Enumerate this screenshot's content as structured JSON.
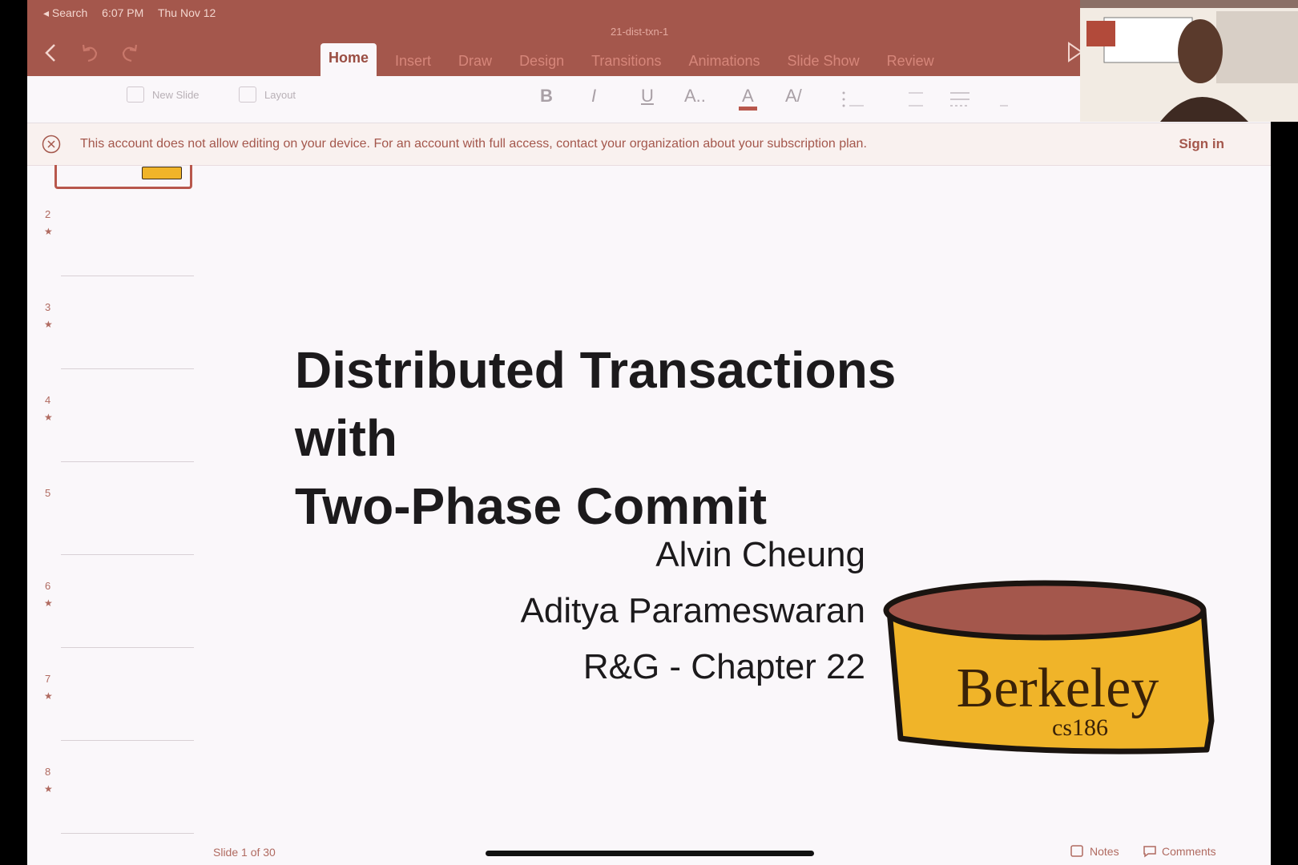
{
  "status_bar": {
    "back": "◂ Search",
    "time": "6:07 PM",
    "date": "Thu Nov 12"
  },
  "document": {
    "title": "21-dist-txn-1"
  },
  "tabs": [
    {
      "label": "Home",
      "active": true
    },
    {
      "label": "Insert"
    },
    {
      "label": "Draw"
    },
    {
      "label": "Design"
    },
    {
      "label": "Transitions"
    },
    {
      "label": "Animations"
    },
    {
      "label": "Slide Show"
    },
    {
      "label": "Review"
    }
  ],
  "ribbon": {
    "new_slide": "New Slide",
    "layout": "Layout",
    "format": {
      "bold": "B",
      "italic": "I",
      "underline": "U",
      "font_size": "A..",
      "font_color": "A",
      "highlight": "A/"
    }
  },
  "banner": {
    "message": "This account does not allow editing on your device. For an account with full access, contact your organization about your subscription plan.",
    "sign_in": "Sign in"
  },
  "thumbnails": [
    {
      "num": "2",
      "star": "★"
    },
    {
      "num": "3",
      "star": "★"
    },
    {
      "num": "4",
      "star": "★"
    },
    {
      "num": "5",
      "star": ""
    },
    {
      "num": "6",
      "star": "★"
    },
    {
      "num": "7",
      "star": "★"
    },
    {
      "num": "8",
      "star": "★"
    }
  ],
  "slide": {
    "title_line1": "Distributed Transactions",
    "title_line2": "with",
    "title_line3": "Two-Phase Commit",
    "author1": "Alvin Cheung",
    "author2": "Aditya Parameswaran",
    "reference": "R&G - Chapter 22",
    "logo_text": "Berkeley",
    "logo_sub": "cs186"
  },
  "footer": {
    "slide_counter": "Slide 1 of 30",
    "notes": "Notes",
    "comments": "Comments"
  },
  "colors": {
    "brand": "#a4574c",
    "logo_gold": "#f0b429",
    "logo_top": "#a4574c"
  }
}
